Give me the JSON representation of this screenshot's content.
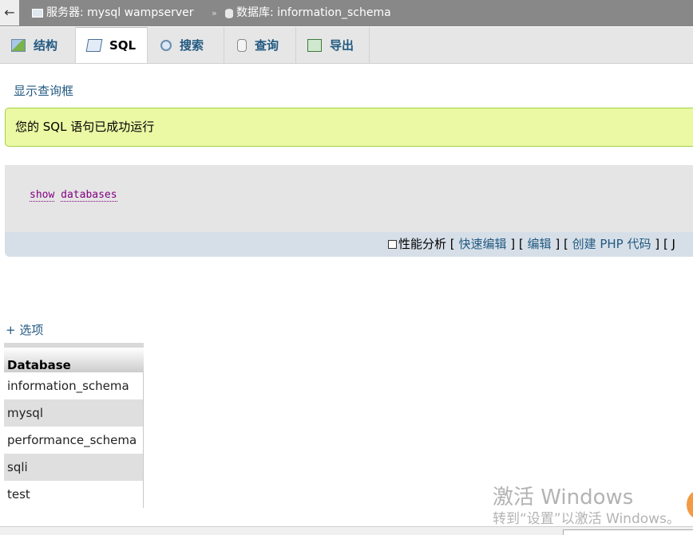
{
  "topbar": {
    "back_glyph": "←",
    "server_label": "服务器: mysql wampserver",
    "separator": "»",
    "database_label": "数据库: information_schema"
  },
  "tabs": [
    {
      "label": "结构",
      "icon": "structure-icon"
    },
    {
      "label": "SQL",
      "icon": "sql-icon",
      "active": true
    },
    {
      "label": "搜索",
      "icon": "search-icon"
    },
    {
      "label": "查询",
      "icon": "query-icon"
    },
    {
      "label": "导出",
      "icon": "export-icon"
    }
  ],
  "show_query_link": "显示查询框",
  "success_message": "您的 SQL 语句已成功运行",
  "sql": {
    "keyword1": "show",
    "keyword2": "databases"
  },
  "query_toolbar": {
    "profiling_label": "性能分析",
    "bracket_open": "[",
    "bracket_close": "]",
    "quick_edit": "快速编辑",
    "edit": "编辑",
    "create_php": "创建 PHP 代码",
    "cut_text": "[ J"
  },
  "options_link": "+ 选项",
  "result_table": {
    "header": "Database",
    "rows": [
      "information_schema",
      "mysql",
      "performance_schema",
      "sqli",
      "test"
    ]
  },
  "watermark": {
    "line1": "激活 Windows",
    "line2": "转到“设置”以激活 Windows。"
  },
  "colors": {
    "accent_link": "#235a81",
    "success_bg": "#ebf8a4",
    "success_border": "#a2d246",
    "sql_keyword": "#800080"
  }
}
